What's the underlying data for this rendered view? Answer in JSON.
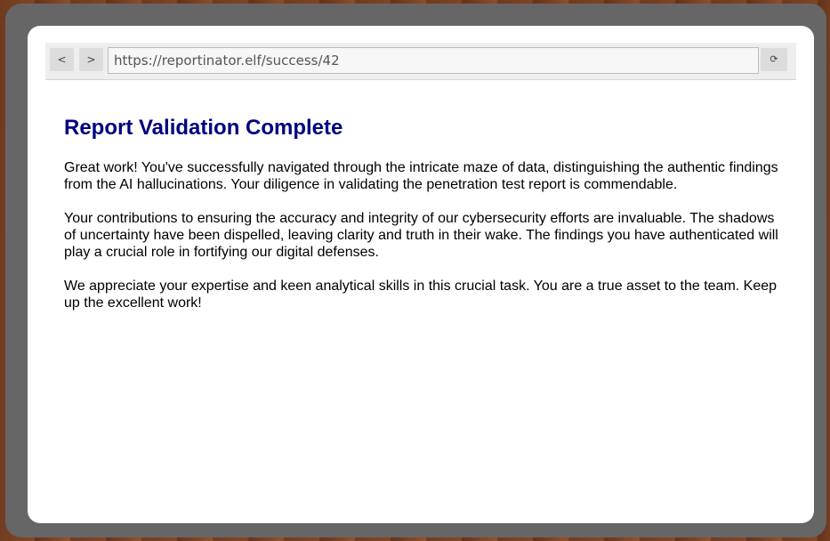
{
  "browser": {
    "back_label": "<",
    "forward_label": ">",
    "url": "https://reportinator.elf/success/42",
    "reload_label": "⟳"
  },
  "page": {
    "title": "Report Validation Complete",
    "paragraphs": [
      "Great work! You've successfully navigated through the intricate maze of data, distinguishing the authentic findings from the AI hallucinations. Your diligence in validating the penetration test report is commendable.",
      "Your contributions to ensuring the accuracy and integrity of our cybersecurity efforts are invaluable. The shadows of uncertainty have been dispelled, leaving clarity and truth in their wake. The findings you have authenticated will play a crucial role in fortifying our digital defenses.",
      "We appreciate your expertise and keen analytical skills in this crucial task. You are a true asset to the team. Keep up the excellent work!"
    ]
  },
  "colors": {
    "title": "#000080",
    "bezel": "#666666",
    "screen": "#ffffff"
  }
}
